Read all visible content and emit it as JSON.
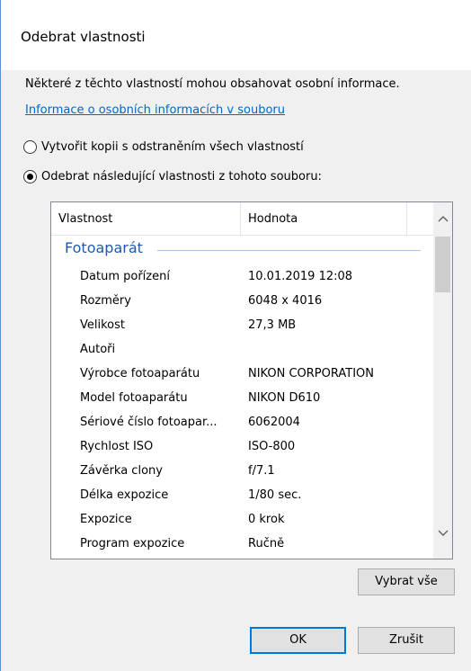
{
  "dialog": {
    "title": "Odebrat vlastnosti",
    "intro": "Některé z těchto vlastností mohou obsahovat osobní informace.",
    "link": "Informace o osobních informacích v souboru"
  },
  "options": {
    "copy_label": "Vytvořit kopii s odstraněním všech vlastností",
    "remove_label": "Odebrat následující vlastnosti z tohoto souboru:",
    "selected": "remove"
  },
  "table": {
    "headers": {
      "property": "Vlastnost",
      "value": "Hodnota"
    },
    "group": "Fotoaparát",
    "rows": [
      {
        "property": "Datum pořízení",
        "value": "10.01.2019 12:08"
      },
      {
        "property": "Rozměry",
        "value": "6048 x 4016"
      },
      {
        "property": "Velikost",
        "value": "27,3 MB"
      },
      {
        "property": "Autoři",
        "value": ""
      },
      {
        "property": "Výrobce fotoaparátu",
        "value": "NIKON CORPORATION"
      },
      {
        "property": "Model fotoaparátu",
        "value": "NIKON D610"
      },
      {
        "property": "Sériové číslo fotoapar...",
        "value": "6062004"
      },
      {
        "property": "Rychlost ISO",
        "value": "ISO-800"
      },
      {
        "property": "Závěrka clony",
        "value": "f/7.1"
      },
      {
        "property": "Délka expozice",
        "value": "1/80 sec."
      },
      {
        "property": "Expozice",
        "value": "0 krok"
      },
      {
        "property": "Program expozice",
        "value": "Ručně"
      }
    ]
  },
  "buttons": {
    "select_all": "Vybrat vše",
    "ok": "OK",
    "cancel": "Zrušit"
  },
  "icons": {
    "scroll_up": "scroll-up-arrow-icon",
    "scroll_down": "scroll-down-arrow-icon"
  }
}
